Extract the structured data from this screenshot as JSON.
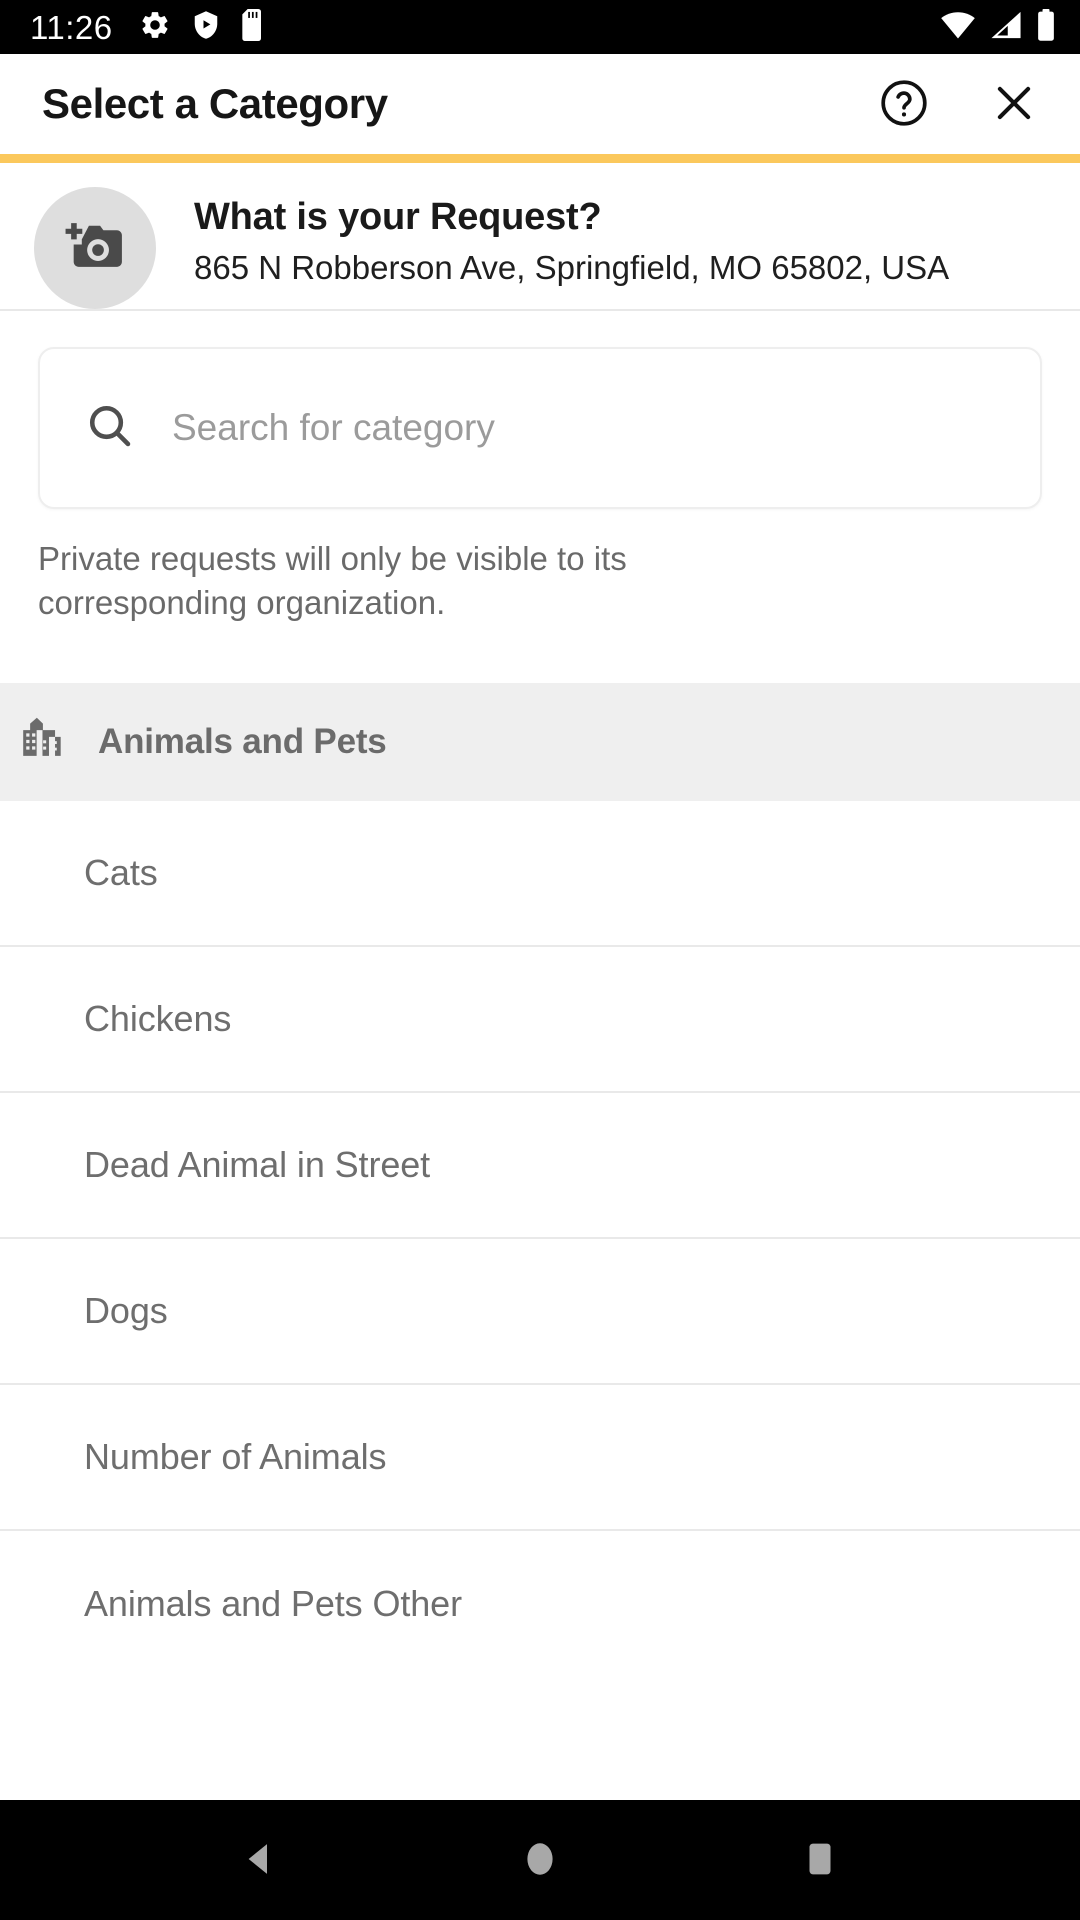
{
  "status_bar": {
    "clock": "11:26",
    "left_icons": [
      "gear-icon",
      "play-protect-shield-icon",
      "sd-card-icon"
    ],
    "right_icons": [
      "wifi-icon",
      "cellular-signal-icon",
      "battery-icon"
    ]
  },
  "header": {
    "title": "Select a Category",
    "help_icon": "help-circle-icon",
    "close_icon": "close-icon",
    "accent_color": "#fbc85c"
  },
  "request": {
    "avatar_icon": "add-photo-camera-icon",
    "title": "What is your Request?",
    "address": "865 N Robberson Ave, Springfield, MO 65802, USA"
  },
  "search": {
    "icon": "search-icon",
    "value": "",
    "placeholder": "Search for category"
  },
  "privacy_note": "Private requests will only be visible to its corresponding organization.",
  "category_group": {
    "icon": "building-city-icon",
    "label": "Animals and Pets",
    "items": [
      {
        "label": "Cats"
      },
      {
        "label": "Chickens"
      },
      {
        "label": "Dead Animal in Street"
      },
      {
        "label": "Dogs"
      },
      {
        "label": "Number of Animals"
      },
      {
        "label": "Animals and Pets Other"
      }
    ]
  },
  "nav_bar": {
    "back_label": "Back",
    "home_label": "Home",
    "recents_label": "Recent apps"
  }
}
